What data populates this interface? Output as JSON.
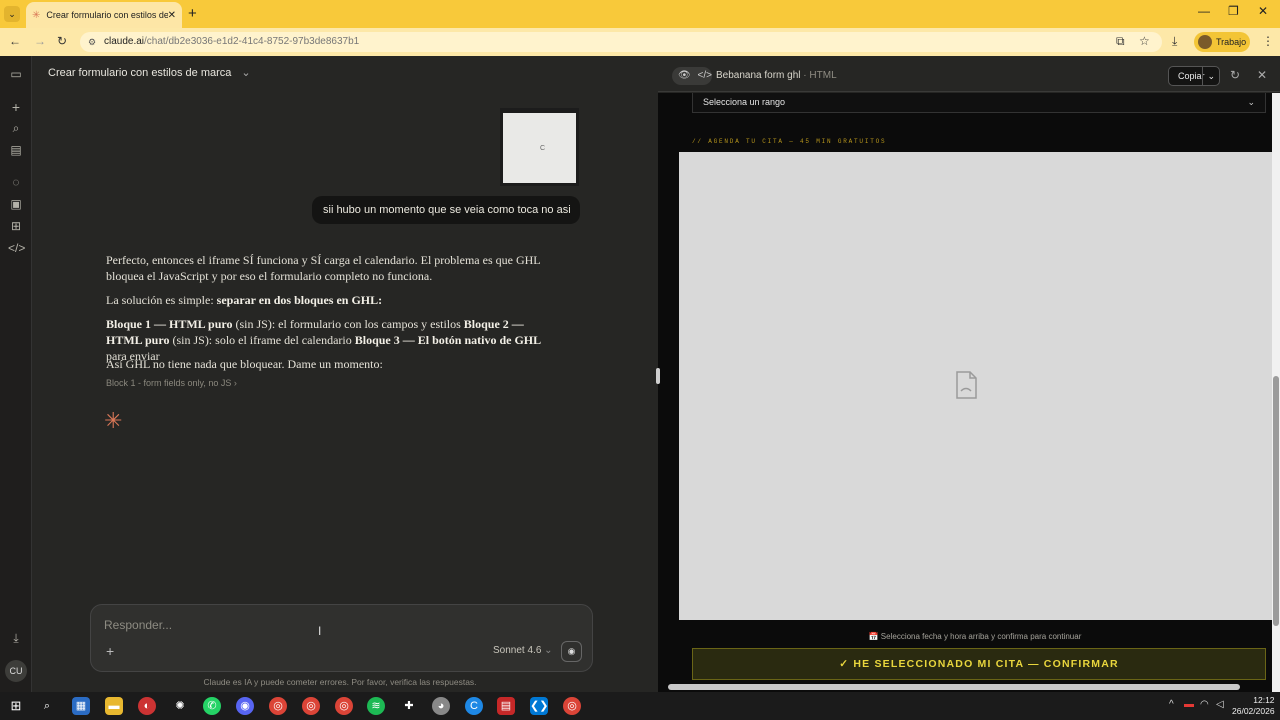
{
  "browser": {
    "tab_title": "Crear formulario con estilos de",
    "url_host": "claude.ai",
    "url_path": "/chat/db2e3036-e1d2-41c4-8752-97b3de8637b1",
    "profile_label": "Trabajo"
  },
  "chat": {
    "title": "Crear formulario con estilos de marca",
    "user_message": "sii hubo un momento que se veia como toca no asi",
    "p1": "Perfecto, entonces el iframe SÍ funciona y SÍ carga el calendario. El problema es que GHL bloquea el JavaScript y por eso el formulario completo no funciona.",
    "p2_prefix": "La solución es simple: ",
    "p2_bold": "separar en dos bloques en GHL:",
    "p3_b1": "Bloque 1 — HTML puro",
    "p3_t1": " (sin JS): el formulario con los campos y estilos ",
    "p3_b2": "Bloque 2 — HTML puro",
    "p3_t2": " (sin JS): solo el iframe del calendario ",
    "p3_b3": "Bloque 3 — El botón nativo de GHL",
    "p3_t3": " para enviar",
    "p4": "Así GHL no tiene nada que bloquear. Dame un momento:",
    "block_line": "Block 1 - form fields only, no JS",
    "composer_placeholder": "Responder...",
    "model": "Sonnet 4.6",
    "disclaimer": "Claude es IA y puede cometer errores. Por favor, verifica las respuestas.",
    "avatar_initials": "CU"
  },
  "artifact": {
    "title": "Bebanana form ghl",
    "type": "HTML",
    "copy_label": "Copiar",
    "select_placeholder": "Selecciona un rango",
    "agenda_label": "// AGENDA TU CITA — 45 MIN GRATUITOS",
    "hint": "📅 Selecciona fecha y hora arriba y confirma para continuar",
    "confirm_label": "✓ HE SELECCIONADO MI CITA — CONFIRMAR"
  },
  "taskbar": {
    "time": "12:12",
    "date": "26/02/2026"
  },
  "colors": {
    "tabbar": "#f8c93a",
    "accent": "#d97757",
    "confirm_text": "#e9d63d"
  }
}
